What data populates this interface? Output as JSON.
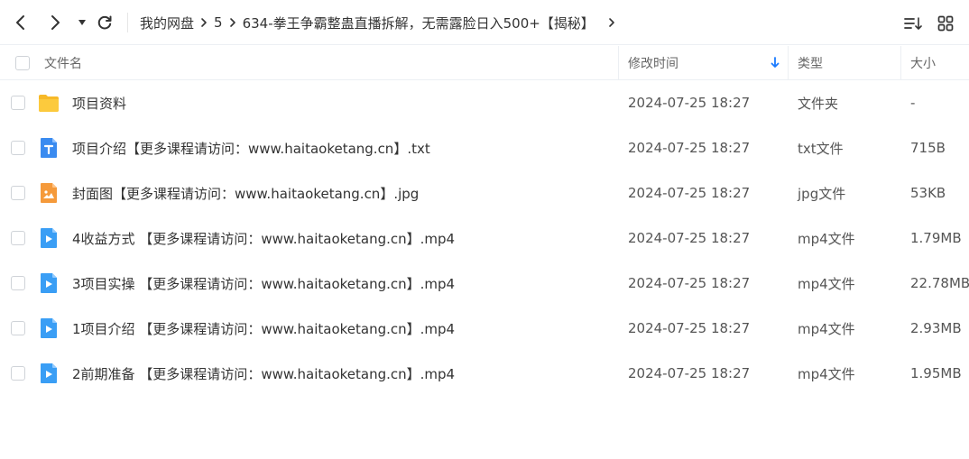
{
  "toolbar": {
    "back_icon": "chevron-left-icon",
    "forward_icon": "chevron-right-icon",
    "dropdown_icon": "caret-down-icon",
    "refresh_icon": "refresh-icon",
    "breadcrumb": [
      {
        "label": "我的网盘"
      },
      {
        "label": "5"
      },
      {
        "label": "634-拳王争霸整蛊直播拆解，无需露脸日入500+【揭秘】"
      }
    ],
    "sort_icon": "sort-list-icon",
    "grid_icon": "grid-view-icon"
  },
  "header": {
    "name": "文件名",
    "modified": "修改时间",
    "type": "类型",
    "size": "大小",
    "sort_indicator": "arrow-down-icon",
    "accent_color": "#1a7bff"
  },
  "files": [
    {
      "name": "项目资料",
      "date": "2024-07-25 18:27",
      "type": "文件夹",
      "size": "-",
      "icon": "folder-icon"
    },
    {
      "name": "项目介绍【更多课程请访问：www.haitaoketang.cn】.txt",
      "date": "2024-07-25 18:27",
      "type": "txt文件",
      "size": "715B",
      "icon": "txt-file-icon"
    },
    {
      "name": "封面图【更多课程请访问：www.haitaoketang.cn】.jpg",
      "date": "2024-07-25 18:27",
      "type": "jpg文件",
      "size": "53KB",
      "icon": "image-file-icon"
    },
    {
      "name": "4收益方式 【更多课程请访问：www.haitaoketang.cn】.mp4",
      "date": "2024-07-25 18:27",
      "type": "mp4文件",
      "size": "1.79MB",
      "icon": "video-file-icon"
    },
    {
      "name": "3项目实操 【更多课程请访问：www.haitaoketang.cn】.mp4",
      "date": "2024-07-25 18:27",
      "type": "mp4文件",
      "size": "22.78MB",
      "icon": "video-file-icon"
    },
    {
      "name": "1项目介绍 【更多课程请访问：www.haitaoketang.cn】.mp4",
      "date": "2024-07-25 18:27",
      "type": "mp4文件",
      "size": "2.93MB",
      "icon": "video-file-icon"
    },
    {
      "name": "2前期准备 【更多课程请访问：www.haitaoketang.cn】.mp4",
      "date": "2024-07-25 18:27",
      "type": "mp4文件",
      "size": "1.95MB",
      "icon": "video-file-icon"
    }
  ]
}
